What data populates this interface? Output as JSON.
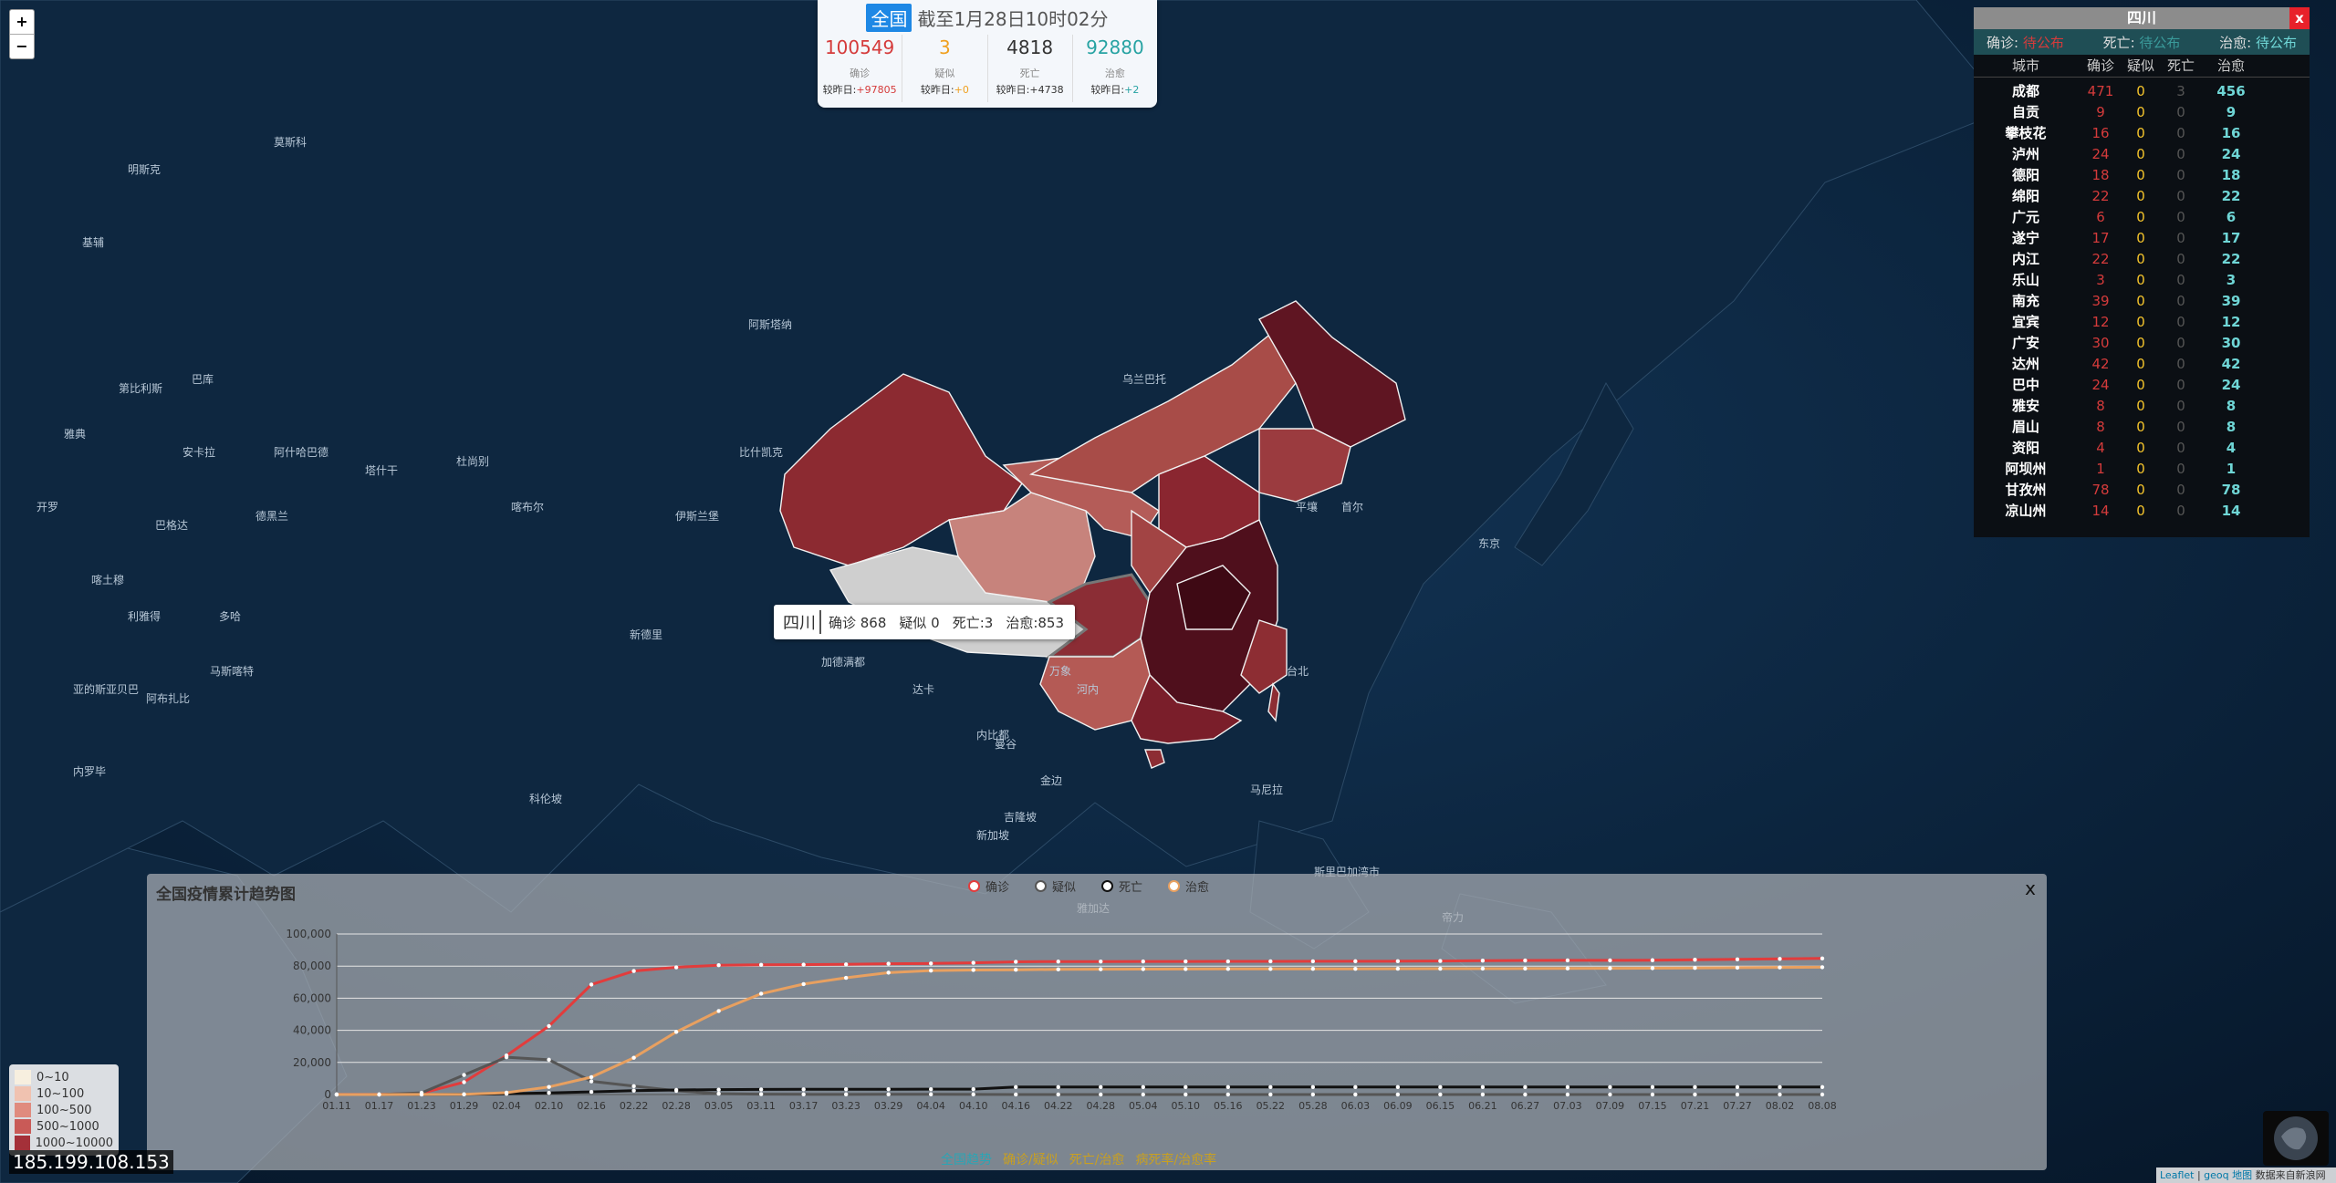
{
  "summary": {
    "scope_badge": "全国",
    "timestamp": "截至1月28日10时02分",
    "confirmed": {
      "value": "100549",
      "label": "确诊",
      "delta_prefix": "较昨日:",
      "delta": "+97805",
      "color": "#d53b3b"
    },
    "suspected": {
      "value": "3",
      "label": "疑似",
      "delta_prefix": "较昨日:",
      "delta": "+0",
      "color": "#f0a020"
    },
    "deaths": {
      "value": "4818",
      "label": "死亡",
      "delta_prefix": "较昨日:",
      "delta": "+4738",
      "color": "#333333"
    },
    "cured": {
      "value": "92880",
      "label": "治愈",
      "delta_prefix": "较昨日:",
      "delta": "+2",
      "color": "#27a3a3"
    }
  },
  "map_controls": {
    "zoom_in": "+",
    "zoom_out": "−"
  },
  "province_panel": {
    "title": "四川",
    "close": "x",
    "stats": {
      "confirmed_label": "确诊:",
      "confirmed_value": "待公布",
      "deaths_label": "死亡:",
      "deaths_value": "待公布",
      "cured_label": "治愈:",
      "cured_value": "待公布"
    },
    "columns": [
      "城市",
      "确诊",
      "疑似",
      "死亡",
      "治愈"
    ],
    "rows": [
      {
        "city": "成都",
        "confirmed": "471",
        "suspected": "0",
        "deaths": "3",
        "cured": "456"
      },
      {
        "city": "自贡",
        "confirmed": "9",
        "suspected": "0",
        "deaths": "0",
        "cured": "9"
      },
      {
        "city": "攀枝花",
        "confirmed": "16",
        "suspected": "0",
        "deaths": "0",
        "cured": "16"
      },
      {
        "city": "泸州",
        "confirmed": "24",
        "suspected": "0",
        "deaths": "0",
        "cured": "24"
      },
      {
        "city": "德阳",
        "confirmed": "18",
        "suspected": "0",
        "deaths": "0",
        "cured": "18"
      },
      {
        "city": "绵阳",
        "confirmed": "22",
        "suspected": "0",
        "deaths": "0",
        "cured": "22"
      },
      {
        "city": "广元",
        "confirmed": "6",
        "suspected": "0",
        "deaths": "0",
        "cured": "6"
      },
      {
        "city": "遂宁",
        "confirmed": "17",
        "suspected": "0",
        "deaths": "0",
        "cured": "17"
      },
      {
        "city": "内江",
        "confirmed": "22",
        "suspected": "0",
        "deaths": "0",
        "cured": "22"
      },
      {
        "city": "乐山",
        "confirmed": "3",
        "suspected": "0",
        "deaths": "0",
        "cured": "3"
      },
      {
        "city": "南充",
        "confirmed": "39",
        "suspected": "0",
        "deaths": "0",
        "cured": "39"
      },
      {
        "city": "宜宾",
        "confirmed": "12",
        "suspected": "0",
        "deaths": "0",
        "cured": "12"
      },
      {
        "city": "广安",
        "confirmed": "30",
        "suspected": "0",
        "deaths": "0",
        "cured": "30"
      },
      {
        "city": "达州",
        "confirmed": "42",
        "suspected": "0",
        "deaths": "0",
        "cured": "42"
      },
      {
        "city": "巴中",
        "confirmed": "24",
        "suspected": "0",
        "deaths": "0",
        "cured": "24"
      },
      {
        "city": "雅安",
        "confirmed": "8",
        "suspected": "0",
        "deaths": "0",
        "cured": "8"
      },
      {
        "city": "眉山",
        "confirmed": "8",
        "suspected": "0",
        "deaths": "0",
        "cured": "8"
      },
      {
        "city": "资阳",
        "confirmed": "4",
        "suspected": "0",
        "deaths": "0",
        "cured": "4"
      },
      {
        "city": "阿坝州",
        "confirmed": "1",
        "suspected": "0",
        "deaths": "0",
        "cured": "1"
      },
      {
        "city": "甘孜州",
        "confirmed": "78",
        "suspected": "0",
        "deaths": "0",
        "cured": "78"
      },
      {
        "city": "凉山州",
        "confirmed": "14",
        "suspected": "0",
        "deaths": "0",
        "cured": "14"
      }
    ]
  },
  "tooltip": {
    "province": "四川",
    "confirmed": "确诊 868",
    "suspected": "疑似 0",
    "deaths": "死亡:3",
    "cured": "治愈:853"
  },
  "map_labels": [
    "阿斯塔纳",
    "比什凯克",
    "乌兰巴托",
    "喀布尔",
    "伊斯兰堡",
    "新德里",
    "加德满都",
    "达卡",
    "内比都",
    "河内",
    "万象",
    "曼谷",
    "金边",
    "马尼拉",
    "首尔",
    "东京",
    "平壤",
    "台北",
    "德黑兰",
    "巴格达",
    "利雅得",
    "多哈",
    "阿布扎比",
    "马斯喀特",
    "科伦坡",
    "吉隆坡",
    "新加坡",
    "雅加达",
    "巴库",
    "第比利斯",
    "阿什哈巴德",
    "塔什干",
    "杜尚别",
    "莫斯科",
    "明斯克",
    "基辅",
    "雅典",
    "安卡拉",
    "开罗",
    "喀土穆",
    "亚的斯亚贝巴",
    "内罗毕",
    "斯里巴加湾市",
    "帝力"
  ],
  "chart": {
    "title": "全国疫情累计趋势图",
    "close": "x",
    "legend": [
      {
        "name": "确诊",
        "color": "#e23c3c"
      },
      {
        "name": "疑似",
        "color": "#555555"
      },
      {
        "name": "死亡",
        "color": "#111111"
      },
      {
        "name": "治愈",
        "color": "#e8a060"
      }
    ],
    "tabs": [
      {
        "label": "全国趋势",
        "color": "#2aa5b5"
      },
      {
        "label": "确诊/疑似",
        "color": "#c9a020"
      },
      {
        "label": "死亡/治愈",
        "color": "#c9a020"
      },
      {
        "label": "病死率/治愈率",
        "color": "#c9a020"
      }
    ]
  },
  "chart_data": {
    "type": "line",
    "title": "全国疫情累计趋势图",
    "x": [
      "01.11",
      "01.17",
      "01.23",
      "01.29",
      "02.04",
      "02.10",
      "02.16",
      "02.22",
      "02.28",
      "03.05",
      "03.11",
      "03.17",
      "03.23",
      "03.29",
      "04.04",
      "04.10",
      "04.16",
      "04.22",
      "04.28",
      "05.04",
      "05.10",
      "05.16",
      "05.22",
      "05.28",
      "06.03",
      "06.09",
      "06.15",
      "06.21",
      "06.27",
      "07.03",
      "07.09",
      "07.15",
      "07.21",
      "07.27",
      "08.02",
      "08.08"
    ],
    "ylim": [
      0,
      100000
    ],
    "yticks": [
      "0",
      "20,000",
      "40,000",
      "60,000",
      "80,000",
      "100,000"
    ],
    "series": [
      {
        "name": "确诊",
        "color": "#e23c3c",
        "values": [
          41,
          45,
          830,
          7711,
          24324,
          42638,
          68500,
          76936,
          79251,
          80552,
          80778,
          80894,
          81093,
          81470,
          81669,
          82052,
          82692,
          82816,
          82858,
          82880,
          82918,
          82947,
          82981,
          83001,
          83022,
          83057,
          83181,
          83396,
          83500,
          83553,
          83585,
          83660,
          84000,
          84200,
          84500,
          84750
        ]
      },
      {
        "name": "疑似",
        "color": "#555555",
        "values": [
          0,
          0,
          1072,
          12167,
          23260,
          21675,
          8228,
          5206,
          2308,
          522,
          253,
          134,
          84,
          115,
          135,
          72,
          16,
          8,
          3,
          2,
          5,
          6,
          4,
          4,
          6,
          5,
          6,
          7,
          3,
          2,
          2,
          3,
          4,
          3,
          3,
          3
        ]
      },
      {
        "name": "死亡",
        "color": "#111111",
        "values": [
          1,
          2,
          25,
          170,
          492,
          1016,
          1665,
          2444,
          2835,
          3042,
          3161,
          3237,
          3277,
          3304,
          3329,
          3339,
          4642,
          4632,
          4633,
          4633,
          4633,
          4634,
          4634,
          4634,
          4634,
          4634,
          4634,
          4634,
          4634,
          4634,
          4634,
          4634,
          4634,
          4634,
          4634,
          4634
        ]
      },
      {
        "name": "治愈",
        "color": "#e8a060",
        "values": [
          0,
          0,
          34,
          133,
          1153,
          4740,
          10844,
          22888,
          39002,
          52045,
          62793,
          68798,
          72703,
          75923,
          77207,
          77575,
          77738,
          77932,
          78053,
          78129,
          78171,
          78222,
          78245,
          78280,
          78315,
          78379,
          78390,
          78420,
          78450,
          78530,
          78620,
          78700,
          78850,
          79020,
          79180,
          79300
        ]
      }
    ]
  },
  "color_legend": {
    "items": [
      {
        "label": "0~10",
        "color": "#f7efdf"
      },
      {
        "label": "10~100",
        "color": "#f0c2b0"
      },
      {
        "label": "100~500",
        "color": "#e08b7e"
      },
      {
        "label": "500~1000",
        "color": "#c95a57"
      },
      {
        "label": "1000~10000",
        "color": "#a43039"
      }
    ]
  },
  "ip_text": "185.199.108.153",
  "attribution": {
    "leaflet": "Leaflet",
    "sep": " | ",
    "geoq": "geoq 地图",
    "text": " 数据来自新浪网"
  }
}
